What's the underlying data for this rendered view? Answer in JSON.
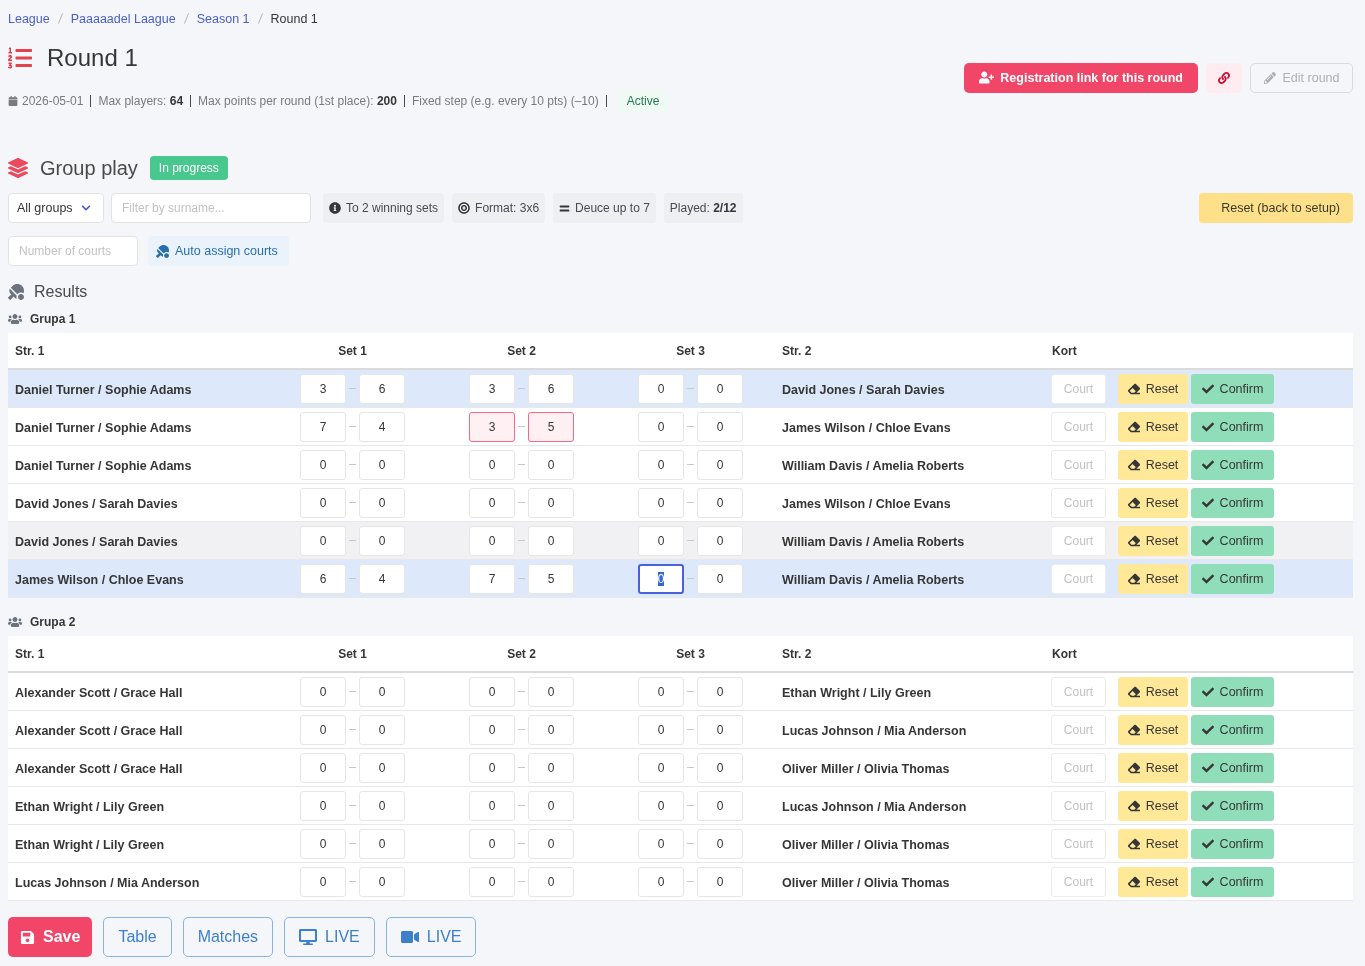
{
  "breadcrumb": [
    {
      "label": "League",
      "current": false
    },
    {
      "label": "Paaaaadel Laague",
      "current": false
    },
    {
      "label": "Season 1",
      "current": false
    },
    {
      "label": "Round 1",
      "current": true
    }
  ],
  "title": "Round 1",
  "meta": [
    {
      "kind": "date",
      "text": "2026-05-01"
    },
    {
      "kind": "text",
      "text": "Max players: **64**"
    },
    {
      "kind": "text",
      "text": "Max points per round (1st place): **200**"
    },
    {
      "kind": "text",
      "text": "Fixed step (e.g. every 10 pts) (–10)"
    }
  ],
  "status_tag": "Active",
  "header_actions": {
    "registration": "Registration link for this round",
    "edit": {
      "label": "Edit round",
      "disabled": true
    }
  },
  "section": {
    "title": "Group play",
    "status": "In progress"
  },
  "group_select": {
    "value": "All groups"
  },
  "surname_filter": {
    "placeholder": "Filter by surname..."
  },
  "info_tags": [
    {
      "kind": "info",
      "text": "To 2 winning sets"
    },
    {
      "kind": "format",
      "text": "Format: 3x6"
    },
    {
      "kind": "deuce",
      "text": "Deuce up to 7"
    },
    {
      "kind": "played",
      "text": "Played: **2/12**"
    }
  ],
  "reset_setup": "Reset (back to setup)",
  "courts_input": {
    "placeholder": "Number of courts"
  },
  "auto_assign": "Auto assign courts",
  "results_title": "Results",
  "groups": [
    {
      "name": "Grupa 1",
      "columns": [
        "Str. 1",
        "Set 1",
        "Set 2",
        "Set 3",
        "Str. 2",
        "Kort"
      ],
      "rows": [
        {
          "team_1": "Daniel Turner / Sophie Adams",
          "selected": true,
          "hovered": false,
          "sets": [
            {
              "invalid": false,
              "scores": [
                {
                  "value": "3",
                  "focused": false
                },
                {
                  "value": "6",
                  "focused": false
                }
              ]
            },
            {
              "invalid": false,
              "scores": [
                {
                  "value": "3",
                  "focused": false
                },
                {
                  "value": "6",
                  "focused": false
                }
              ]
            },
            {
              "invalid": false,
              "scores": [
                {
                  "value": "0",
                  "focused": false
                },
                {
                  "value": "0",
                  "focused": false
                }
              ]
            }
          ],
          "team_2": "David Jones / Sarah Davies",
          "court_placeholder": "Court",
          "reset": "Reset",
          "confirm": "Confirm"
        },
        {
          "team_1": "Daniel Turner / Sophie Adams",
          "selected": false,
          "hovered": false,
          "sets": [
            {
              "invalid": false,
              "scores": [
                {
                  "value": "7",
                  "focused": false
                },
                {
                  "value": "4",
                  "focused": false
                }
              ]
            },
            {
              "invalid": true,
              "scores": [
                {
                  "value": "3",
                  "focused": false
                },
                {
                  "value": "5",
                  "focused": false
                }
              ]
            },
            {
              "invalid": false,
              "scores": [
                {
                  "value": "0",
                  "focused": false
                },
                {
                  "value": "0",
                  "focused": false
                }
              ]
            }
          ],
          "team_2": "James Wilson / Chloe Evans",
          "court_placeholder": "Court",
          "reset": "Reset",
          "confirm": "Confirm"
        },
        {
          "team_1": "Daniel Turner / Sophie Adams",
          "selected": false,
          "hovered": false,
          "sets": [
            {
              "invalid": false,
              "scores": [
                {
                  "value": "0",
                  "focused": false
                },
                {
                  "value": "0",
                  "focused": false
                }
              ]
            },
            {
              "invalid": false,
              "scores": [
                {
                  "value": "0",
                  "focused": false
                },
                {
                  "value": "0",
                  "focused": false
                }
              ]
            },
            {
              "invalid": false,
              "scores": [
                {
                  "value": "0",
                  "focused": false
                },
                {
                  "value": "0",
                  "focused": false
                }
              ]
            }
          ],
          "team_2": "William Davis / Amelia Roberts",
          "court_placeholder": "Court",
          "reset": "Reset",
          "confirm": "Confirm"
        },
        {
          "team_1": "David Jones / Sarah Davies",
          "selected": false,
          "hovered": false,
          "sets": [
            {
              "invalid": false,
              "scores": [
                {
                  "value": "0",
                  "focused": false
                },
                {
                  "value": "0",
                  "focused": false
                }
              ]
            },
            {
              "invalid": false,
              "scores": [
                {
                  "value": "0",
                  "focused": false
                },
                {
                  "value": "0",
                  "focused": false
                }
              ]
            },
            {
              "invalid": false,
              "scores": [
                {
                  "value": "0",
                  "focused": false
                },
                {
                  "value": "0",
                  "focused": false
                }
              ]
            }
          ],
          "team_2": "James Wilson / Chloe Evans",
          "court_placeholder": "Court",
          "reset": "Reset",
          "confirm": "Confirm"
        },
        {
          "team_1": "David Jones / Sarah Davies",
          "selected": false,
          "hovered": true,
          "sets": [
            {
              "invalid": false,
              "scores": [
                {
                  "value": "0",
                  "focused": false
                },
                {
                  "value": "0",
                  "focused": false
                }
              ]
            },
            {
              "invalid": false,
              "scores": [
                {
                  "value": "0",
                  "focused": false
                },
                {
                  "value": "0",
                  "focused": false
                }
              ]
            },
            {
              "invalid": false,
              "scores": [
                {
                  "value": "0",
                  "focused": false
                },
                {
                  "value": "0",
                  "focused": false
                }
              ]
            }
          ],
          "team_2": "William Davis / Amelia Roberts",
          "court_placeholder": "Court",
          "reset": "Reset",
          "confirm": "Confirm"
        },
        {
          "team_1": "James Wilson / Chloe Evans",
          "selected": true,
          "hovered": false,
          "sets": [
            {
              "invalid": false,
              "scores": [
                {
                  "value": "6",
                  "focused": false
                },
                {
                  "value": "4",
                  "focused": false
                }
              ]
            },
            {
              "invalid": false,
              "scores": [
                {
                  "value": "7",
                  "focused": false
                },
                {
                  "value": "5",
                  "focused": false
                }
              ]
            },
            {
              "invalid": false,
              "scores": [
                {
                  "value": "0",
                  "focused": true
                },
                {
                  "value": "0",
                  "focused": false
                }
              ]
            }
          ],
          "team_2": "William Davis / Amelia Roberts",
          "court_placeholder": "Court",
          "reset": "Reset",
          "confirm": "Confirm"
        }
      ]
    },
    {
      "name": "Grupa 2",
      "columns": [
        "Str. 1",
        "Set 1",
        "Set 2",
        "Set 3",
        "Str. 2",
        "Kort"
      ],
      "rows": [
        {
          "team_1": "Alexander Scott / Grace Hall",
          "selected": false,
          "hovered": false,
          "sets": [
            {
              "invalid": false,
              "scores": [
                {
                  "value": "0",
                  "focused": false
                },
                {
                  "value": "0",
                  "focused": false
                }
              ]
            },
            {
              "invalid": false,
              "scores": [
                {
                  "value": "0",
                  "focused": false
                },
                {
                  "value": "0",
                  "focused": false
                }
              ]
            },
            {
              "invalid": false,
              "scores": [
                {
                  "value": "0",
                  "focused": false
                },
                {
                  "value": "0",
                  "focused": false
                }
              ]
            }
          ],
          "team_2": "Ethan Wright / Lily Green",
          "court_placeholder": "Court",
          "reset": "Reset",
          "confirm": "Confirm"
        },
        {
          "team_1": "Alexander Scott / Grace Hall",
          "selected": false,
          "hovered": false,
          "sets": [
            {
              "invalid": false,
              "scores": [
                {
                  "value": "0",
                  "focused": false
                },
                {
                  "value": "0",
                  "focused": false
                }
              ]
            },
            {
              "invalid": false,
              "scores": [
                {
                  "value": "0",
                  "focused": false
                },
                {
                  "value": "0",
                  "focused": false
                }
              ]
            },
            {
              "invalid": false,
              "scores": [
                {
                  "value": "0",
                  "focused": false
                },
                {
                  "value": "0",
                  "focused": false
                }
              ]
            }
          ],
          "team_2": "Lucas Johnson / Mia Anderson",
          "court_placeholder": "Court",
          "reset": "Reset",
          "confirm": "Confirm"
        },
        {
          "team_1": "Alexander Scott / Grace Hall",
          "selected": false,
          "hovered": false,
          "sets": [
            {
              "invalid": false,
              "scores": [
                {
                  "value": "0",
                  "focused": false
                },
                {
                  "value": "0",
                  "focused": false
                }
              ]
            },
            {
              "invalid": false,
              "scores": [
                {
                  "value": "0",
                  "focused": false
                },
                {
                  "value": "0",
                  "focused": false
                }
              ]
            },
            {
              "invalid": false,
              "scores": [
                {
                  "value": "0",
                  "focused": false
                },
                {
                  "value": "0",
                  "focused": false
                }
              ]
            }
          ],
          "team_2": "Oliver Miller / Olivia Thomas",
          "court_placeholder": "Court",
          "reset": "Reset",
          "confirm": "Confirm"
        },
        {
          "team_1": "Ethan Wright / Lily Green",
          "selected": false,
          "hovered": false,
          "sets": [
            {
              "invalid": false,
              "scores": [
                {
                  "value": "0",
                  "focused": false
                },
                {
                  "value": "0",
                  "focused": false
                }
              ]
            },
            {
              "invalid": false,
              "scores": [
                {
                  "value": "0",
                  "focused": false
                },
                {
                  "value": "0",
                  "focused": false
                }
              ]
            },
            {
              "invalid": false,
              "scores": [
                {
                  "value": "0",
                  "focused": false
                },
                {
                  "value": "0",
                  "focused": false
                }
              ]
            }
          ],
          "team_2": "Lucas Johnson / Mia Anderson",
          "court_placeholder": "Court",
          "reset": "Reset",
          "confirm": "Confirm"
        },
        {
          "team_1": "Ethan Wright / Lily Green",
          "selected": false,
          "hovered": false,
          "sets": [
            {
              "invalid": false,
              "scores": [
                {
                  "value": "0",
                  "focused": false
                },
                {
                  "value": "0",
                  "focused": false
                }
              ]
            },
            {
              "invalid": false,
              "scores": [
                {
                  "value": "0",
                  "focused": false
                },
                {
                  "value": "0",
                  "focused": false
                }
              ]
            },
            {
              "invalid": false,
              "scores": [
                {
                  "value": "0",
                  "focused": false
                },
                {
                  "value": "0",
                  "focused": false
                }
              ]
            }
          ],
          "team_2": "Oliver Miller / Olivia Thomas",
          "court_placeholder": "Court",
          "reset": "Reset",
          "confirm": "Confirm"
        },
        {
          "team_1": "Lucas Johnson / Mia Anderson",
          "selected": false,
          "hovered": false,
          "sets": [
            {
              "invalid": false,
              "scores": [
                {
                  "value": "0",
                  "focused": false
                },
                {
                  "value": "0",
                  "focused": false
                }
              ]
            },
            {
              "invalid": false,
              "scores": [
                {
                  "value": "0",
                  "focused": false
                },
                {
                  "value": "0",
                  "focused": false
                }
              ]
            },
            {
              "invalid": false,
              "scores": [
                {
                  "value": "0",
                  "focused": false
                },
                {
                  "value": "0",
                  "focused": false
                }
              ]
            }
          ],
          "team_2": "Oliver Miller / Olivia Thomas",
          "court_placeholder": "Court",
          "reset": "Reset",
          "confirm": "Confirm"
        }
      ]
    }
  ],
  "footer_buttons": [
    {
      "kind": "save",
      "label": "Save"
    },
    {
      "kind": "outline",
      "label": "Table"
    },
    {
      "kind": "outline",
      "label": "Matches"
    },
    {
      "kind": "screen",
      "label": "LIVE"
    },
    {
      "kind": "video",
      "label": "LIVE"
    }
  ]
}
